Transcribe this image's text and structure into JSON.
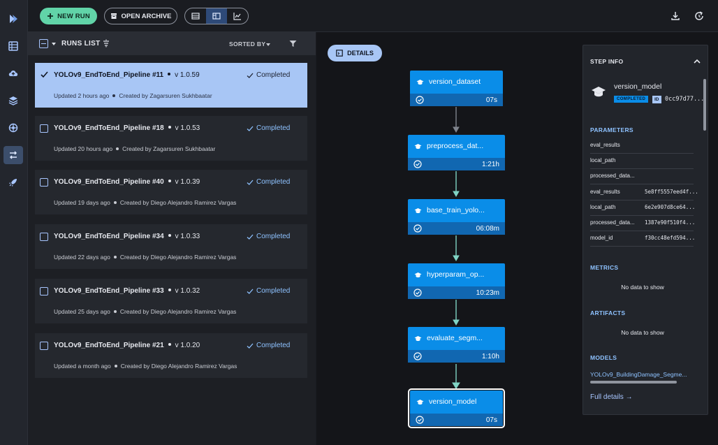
{
  "toolbar": {
    "new_run_label": "NEW RUN",
    "open_archive_label": "OPEN ARCHIVE",
    "view_modes": [
      "table-view",
      "details-view",
      "chart-view"
    ],
    "selected_view": "details-view"
  },
  "runs_list": {
    "title": "RUNS LIST",
    "sorted_by_label": "SORTED BY",
    "runs": [
      {
        "name": "YOLOv9_EndToEnd_Pipeline #11",
        "version": "v 1.0.59",
        "status": "Completed",
        "updated": "Updated 2 hours ago",
        "creator": "Created by Zagarsuren Sukhbaatar",
        "selected": true
      },
      {
        "name": "YOLOv9_EndToEnd_Pipeline #18",
        "version": "v 1.0.53",
        "status": "Completed",
        "updated": "Updated 20 hours ago",
        "creator": "Created by Zagarsuren Sukhbaatar",
        "selected": false
      },
      {
        "name": "YOLOv9_EndToEnd_Pipeline #40",
        "version": "v 1.0.39",
        "status": "Completed",
        "updated": "Updated 19 days ago",
        "creator": "Created by Diego Alejandro Ramirez Vargas",
        "selected": false
      },
      {
        "name": "YOLOv9_EndToEnd_Pipeline #34",
        "version": "v 1.0.33",
        "status": "Completed",
        "updated": "Updated 22 days ago",
        "creator": "Created by Diego Alejandro Ramirez Vargas",
        "selected": false
      },
      {
        "name": "YOLOv9_EndToEnd_Pipeline #33",
        "version": "v 1.0.32",
        "status": "Completed",
        "updated": "Updated 25 days ago",
        "creator": "Created by Diego Alejandro Ramirez Vargas",
        "selected": false
      },
      {
        "name": "YOLOv9_EndToEnd_Pipeline #21",
        "version": "v 1.0.20",
        "status": "Completed",
        "updated": "Updated a month ago",
        "creator": "Created by Diego Alejandro Ramirez Vargas",
        "selected": false
      }
    ]
  },
  "dag": {
    "details_label": "DETAILS",
    "steps": [
      {
        "name": "version_dataset",
        "duration": "07s"
      },
      {
        "name": "preprocess_dat...",
        "duration": "1:21h"
      },
      {
        "name": "base_train_yolo...",
        "duration": "06:08m"
      },
      {
        "name": "hyperparam_op...",
        "duration": "10:23m"
      },
      {
        "name": "evaluate_segm...",
        "duration": "1:10h"
      },
      {
        "name": "version_model",
        "duration": "07s",
        "selected": true
      }
    ]
  },
  "step_info": {
    "title": "STEP INFO",
    "model_name": "version_model",
    "status_badge": "COMPLETED",
    "id_label": "ID",
    "id_value": "0cc97d77...",
    "parameters_title": "PARAMETERS",
    "parameters": [
      {
        "key": "eval_results",
        "value": ""
      },
      {
        "key": "local_path",
        "value": ""
      },
      {
        "key": "processed_data...",
        "value": ""
      },
      {
        "key": "eval_results",
        "value": "5e8ff5557eed4f..."
      },
      {
        "key": "local_path",
        "value": "6e2e907d8ce64..."
      },
      {
        "key": "processed_data...",
        "value": "1387e90f510f4..."
      },
      {
        "key": "model_id",
        "value": "f30cc48efd594..."
      }
    ],
    "metrics_title": "METRICS",
    "metrics_empty": "No data to show",
    "artifacts_title": "ARTIFACTS",
    "artifacts_empty": "No data to show",
    "models_title": "MODELS",
    "model_link": "YOLOv9_BuildingDamage_Segme...",
    "full_details_label": "Full details →"
  },
  "colors": {
    "accent_green": "#61d4a8",
    "node_blue": "#0a8de8",
    "link_blue": "#8ec2ff",
    "selected_card": "#a8c6f5"
  }
}
